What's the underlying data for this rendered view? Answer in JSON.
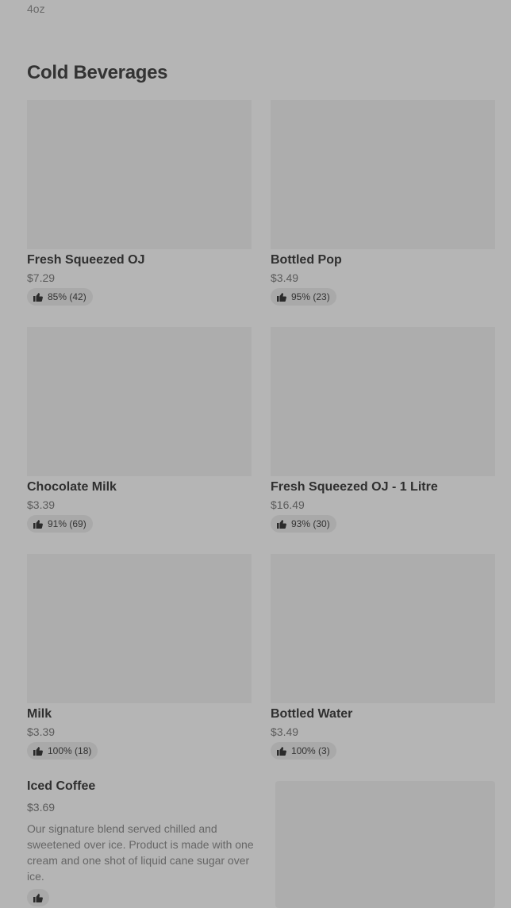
{
  "previous_item": {
    "size": "4oz"
  },
  "section": {
    "title": "Cold Beverages"
  },
  "items": [
    {
      "name": "Fresh Squeezed OJ",
      "price": "$7.29",
      "rating": "85% (42)"
    },
    {
      "name": "Bottled Pop",
      "price": "$3.49",
      "rating": "95% (23)"
    },
    {
      "name": "Chocolate Milk",
      "price": "$3.39",
      "rating": "91% (69)"
    },
    {
      "name": "Fresh Squeezed OJ - 1 Litre",
      "price": "$16.49",
      "rating": "93% (30)"
    },
    {
      "name": "Milk",
      "price": "$3.39",
      "rating": "100% (18)"
    },
    {
      "name": "Bottled Water",
      "price": "$3.49",
      "rating": "100% (3)"
    }
  ],
  "featured": {
    "name": "Iced Coffee",
    "price": "$3.69",
    "description": "Our signature blend served chilled and sweetened over ice. Product is made with one cream and one shot of liquid cane sugar over ice."
  },
  "icons": {
    "rating": "thumbs-up-icon"
  }
}
